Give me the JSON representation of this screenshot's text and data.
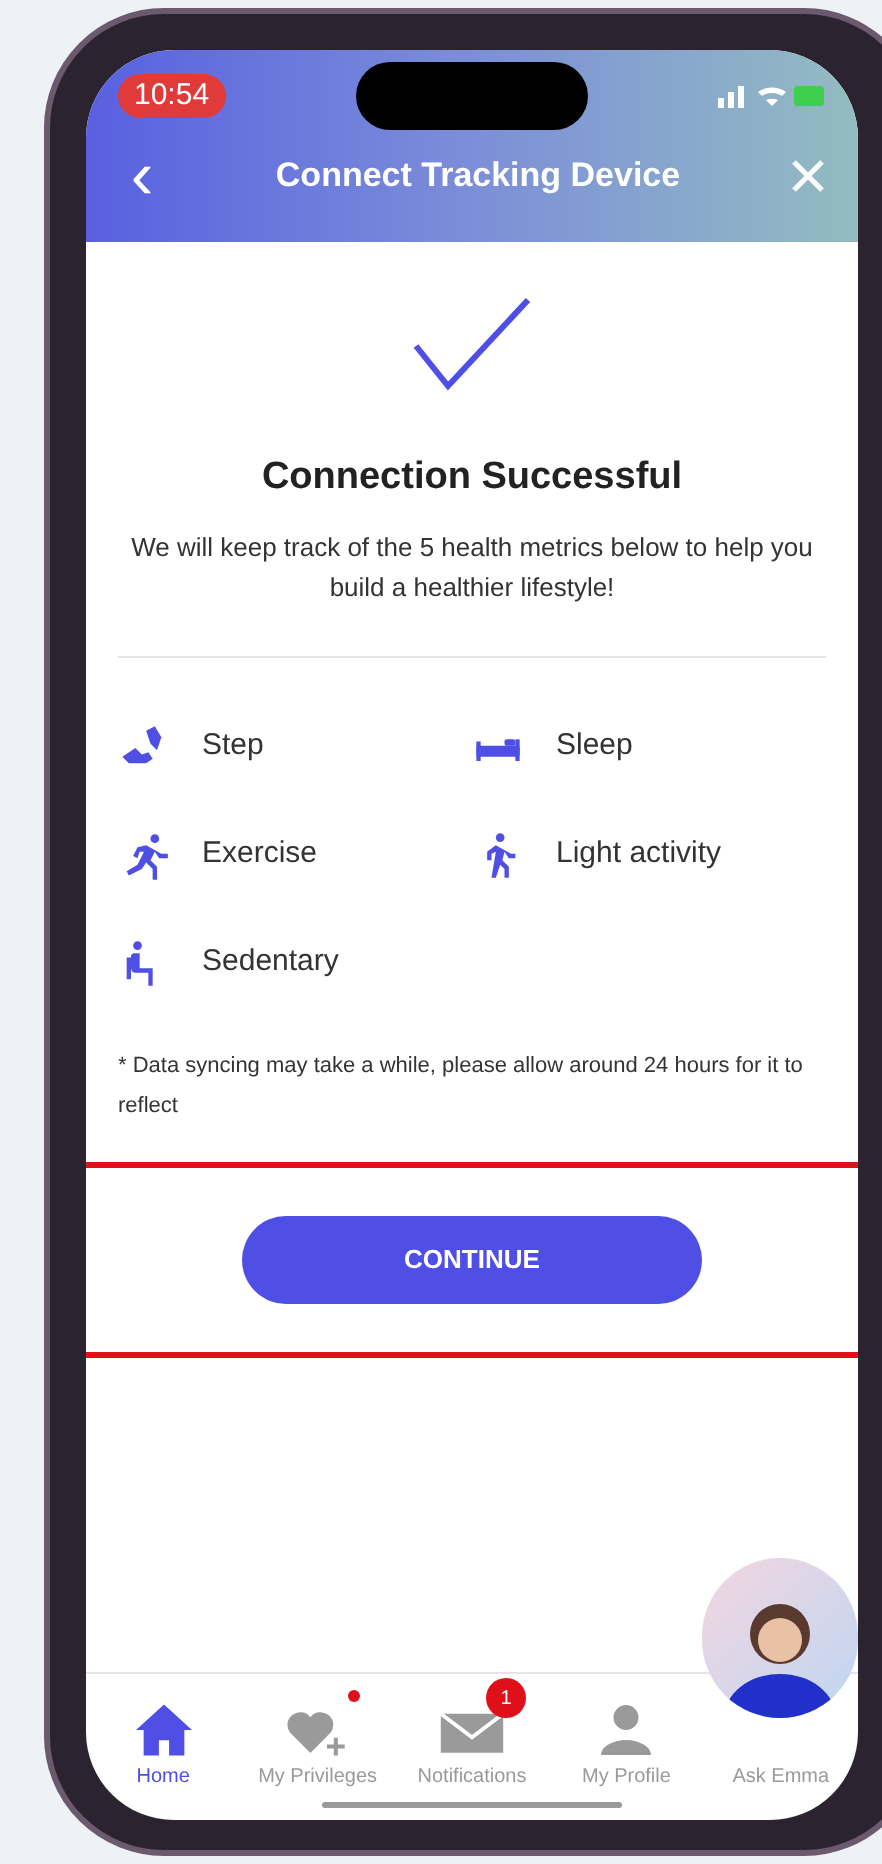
{
  "status_bar": {
    "time": "10:54"
  },
  "header": {
    "back_icon": "‹",
    "title": "Connect Tracking Device"
  },
  "success": {
    "title": "Connection Successful",
    "message": "We will keep track of the 5 health metrics below to help you build a healthier lifestyle!"
  },
  "metrics": [
    {
      "kind": "step",
      "label": "Step"
    },
    {
      "kind": "sleep",
      "label": "Sleep"
    },
    {
      "kind": "exercise",
      "label": "Exercise"
    },
    {
      "kind": "walk",
      "label": "Light activity"
    },
    {
      "kind": "sedentary",
      "label": "Sedentary"
    }
  ],
  "note": "* Data syncing may take a while, please allow around 24 hours for it to reflect",
  "continue_button": "CONTINUE",
  "tab_bar": [
    {
      "kind": "home",
      "label": "Home",
      "selected": true
    },
    {
      "kind": "privileges",
      "label": "My Privileges",
      "selected": false,
      "dot": true
    },
    {
      "kind": "notifications",
      "label": "Notifications",
      "selected": false,
      "badge": "1"
    },
    {
      "kind": "profile",
      "label": "My Profile",
      "selected": false
    },
    {
      "kind": "assistant",
      "label": "Ask Emma",
      "selected": false
    }
  ]
}
